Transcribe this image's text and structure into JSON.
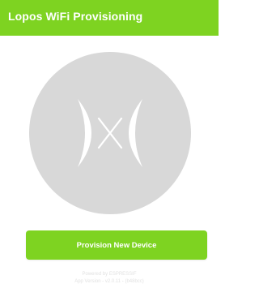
{
  "app_bar": {
    "title": "Lopos WiFi Provisioning"
  },
  "logo": {
    "icon": "espressif-logo-icon",
    "background_color": "#d8d8d8",
    "mark_color": "#ffffff"
  },
  "actions": {
    "provision_label": "Provision New Device"
  },
  "footer": {
    "powered_by": "Powered by ESPRESSIF",
    "app_version": "App Version - v2.0.11 - (b48bcc)"
  },
  "colors": {
    "accent": "#7ed321",
    "text_on_accent": "#ffffff",
    "footer_text": "#e2e2e2"
  }
}
